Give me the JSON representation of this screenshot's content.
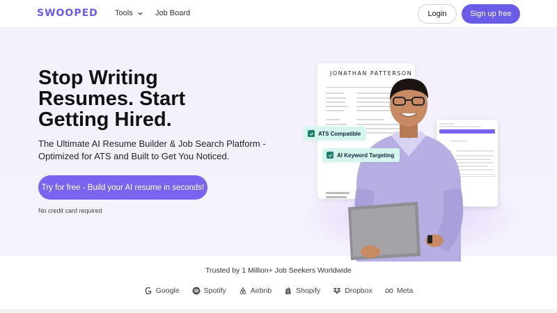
{
  "nav": {
    "logo": "SWOOPED",
    "tools_label": "Tools",
    "job_board_label": "Job Board",
    "login_label": "Login",
    "signup_label": "Sign up free"
  },
  "hero": {
    "title": "Stop Writing Resumes. Start Getting Hired.",
    "subtitle": "The Ultimate AI Resume Builder & Job Search Platform - Optimized for ATS and Built to Get You Noticed.",
    "cta_label": "Try for free - Build your AI resume in seconds!",
    "no_credit_card": "No credit card required",
    "resume_name": "JONATHAN PATTERSON",
    "badge_ats": "ATS Compatible",
    "badge_keyword": "AI Keyword Targeting"
  },
  "trust": {
    "headline": "Trusted by 1 Million+ Job Seekers Worldwide",
    "brands": [
      "Google",
      "Spotify",
      "Airbnb",
      "Shopify",
      "Dropbox",
      "Meta"
    ]
  },
  "colors": {
    "brand": "#6b5ce7",
    "cta": "#7a63ee",
    "badge_bg": "#d5f5ef",
    "hero_bg": "#f4f0fc"
  },
  "icons": [
    "chevron-down-icon",
    "check-icon",
    "google-icon",
    "spotify-icon",
    "airbnb-icon",
    "shopify-icon",
    "dropbox-icon",
    "meta-icon"
  ]
}
